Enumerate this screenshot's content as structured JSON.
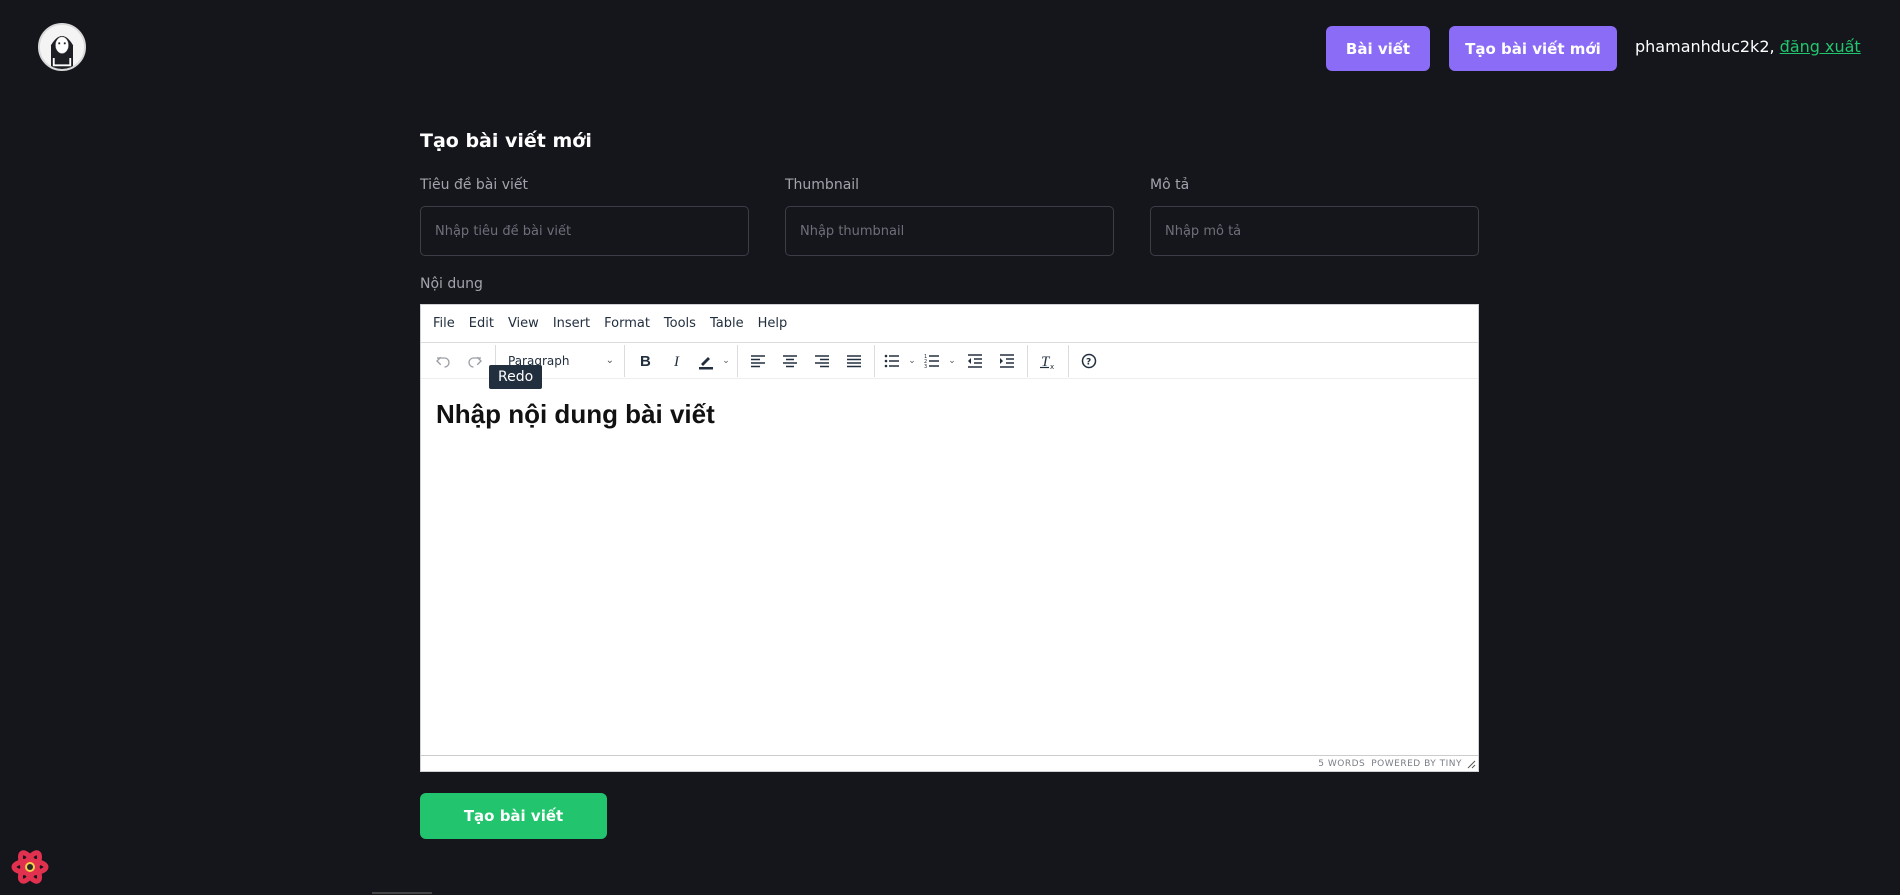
{
  "header": {
    "avatar_icon": "avatar-icon",
    "posts_button": "Bài viết",
    "create_button": "Tạo bài viết mới",
    "username": "phamanhduc2k2,",
    "logout": "đăng xuất"
  },
  "form": {
    "title": "Tạo bài viết mới",
    "fields": [
      {
        "label": "Tiêu đề bài viết",
        "placeholder": "Nhập tiêu đề bài viết",
        "value": ""
      },
      {
        "label": "Thumbnail",
        "placeholder": "Nhập thumbnail",
        "value": ""
      },
      {
        "label": "Mô tả",
        "placeholder": "Nhập mô tả",
        "value": ""
      }
    ],
    "content_label": "Nội dung",
    "submit_button": "Tạo bài viết"
  },
  "editor": {
    "menu": [
      "File",
      "Edit",
      "View",
      "Insert",
      "Format",
      "Tools",
      "Table",
      "Help"
    ],
    "block_format": "Paragraph",
    "tooltip": "Redo",
    "content_heading": "Nhập nội dung bài viết",
    "word_count": "5 WORDS",
    "branding": "POWERED BY TINY"
  },
  "colors": {
    "background": "#15161c",
    "accent_purple": "#8b6cf6",
    "accent_green": "#22c56e"
  }
}
